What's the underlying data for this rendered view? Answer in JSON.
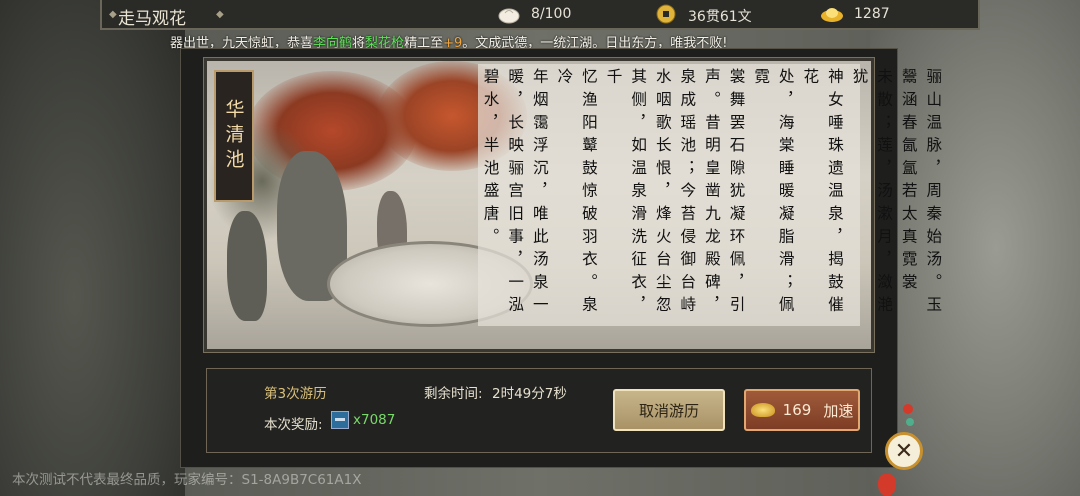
{
  "header": {
    "title": "走马观花",
    "resources": [
      {
        "icon": "bun-icon",
        "value": "8/100"
      },
      {
        "icon": "copper-coin-icon",
        "value": "36贯61文"
      },
      {
        "icon": "gold-ingot-icon",
        "value": "1287"
      }
    ]
  },
  "marquee": {
    "part1": "器出世，九天惊虹，恭喜",
    "player": "李向鹤",
    "part2": "将",
    "item": "梨花枪",
    "part3": "精工至",
    "level": "+9",
    "part4": "。文成武德，一统江湖。日出东方，唯我不败!"
  },
  "scene": {
    "place_name": "华清池",
    "poem_columns": [
      "骊山温脉，周秦始汤。玉",
      "鬶涵春氤氲若太真霓裳",
      "未散；莲，汤漱月，潋滟犹",
      "神女唾珠遗温泉，揭鼓催花",
      "处，海棠睡暖凝脂滑；佩霓",
      "裳舞罢石隙犹凝环佩，引",
      "声。昔明皇凿九龙殿碑，",
      "泉成瑶池；今苔侵御台峙",
      "水咽歌长恨，烽火台尘忽",
      "其侧，如温泉滑洗征衣，千",
      "忆渔阳鼙鼓惊破羽衣。泉冷",
      "年烟霭浮沉，唯此汤泉一",
      "暖，长映骊宫旧事，一泓",
      "碧水，半池盛唐。"
    ]
  },
  "journey": {
    "count_label": "第3次游历",
    "time_label": "剩余时间:",
    "time_value": "2时49分7秒",
    "reward_label": "本次奖励:",
    "reward_qty": "x7087",
    "cancel_label": "取消游历",
    "speed_cost": "169",
    "speed_label": "加速"
  },
  "watermark": "本次测试不代表最终品质，玩家编号：S1-8A9B7C61A1X"
}
